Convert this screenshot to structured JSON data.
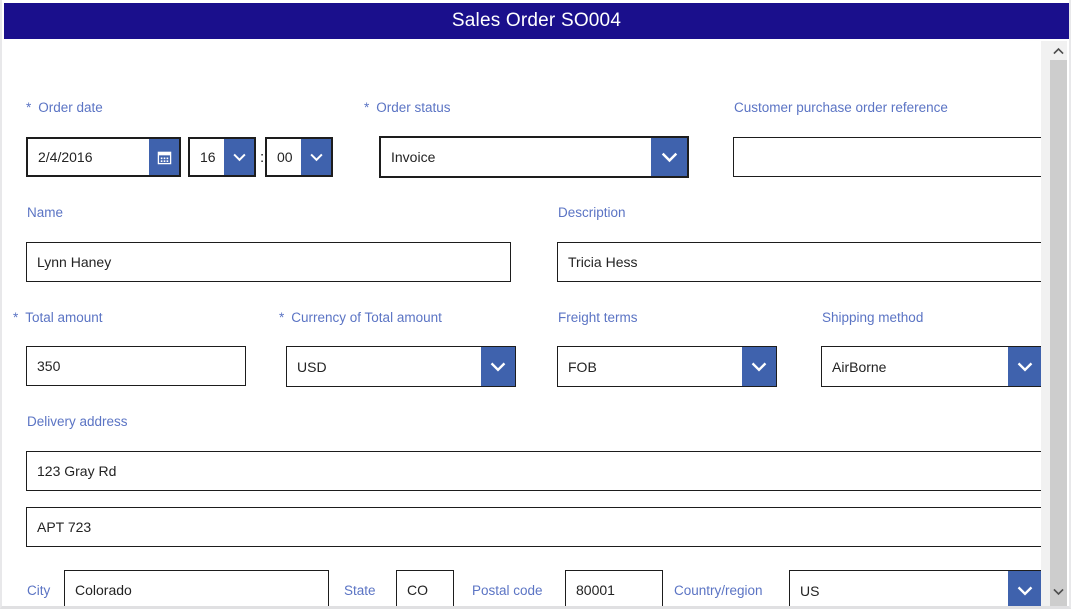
{
  "window": {
    "title": "Sales Order SO004"
  },
  "colors": {
    "title_bar": "#1a0f8c",
    "accent_blue": "#3f62ad",
    "label_blue": "#5b74c4",
    "field_border": "#1d1d1d"
  },
  "icons": {
    "calendar": "calendar-icon",
    "chevron_down": "chevron-down-icon",
    "scroll_up": "chevron-up-icon",
    "scroll_down": "chevron-down-icon"
  },
  "form": {
    "order_date": {
      "label": "Order date",
      "required_marker": "*",
      "value": "2/4/2016",
      "placeholder": "",
      "hour": "16",
      "minute": "00",
      "time_separator": ":"
    },
    "order_status": {
      "label": "Order status",
      "required_marker": "*",
      "value": "Invoice"
    },
    "customer_po_reference": {
      "label": "Customer purchase order reference",
      "value": "",
      "placeholder": ""
    },
    "name": {
      "label": "Name",
      "value": "Lynn Haney"
    },
    "description": {
      "label": "Description",
      "value": "Tricia Hess"
    },
    "total_amount": {
      "label": "Total amount",
      "required_marker": "*",
      "value": "350"
    },
    "currency": {
      "label": "Currency of Total amount",
      "required_marker": "*",
      "value": "USD"
    },
    "freight_terms": {
      "label": "Freight terms",
      "value": "FOB"
    },
    "shipping_method": {
      "label": "Shipping method",
      "value": "AirBorne"
    },
    "delivery_address": {
      "label": "Delivery address",
      "line1": "123 Gray Rd",
      "line2": "APT 723"
    },
    "city": {
      "label": "City",
      "value": "Colorado"
    },
    "state": {
      "label": "State",
      "value": "CO"
    },
    "postal_code": {
      "label": "Postal code",
      "value": "80001"
    },
    "country_region": {
      "label": "Country/region",
      "value": "US"
    }
  }
}
